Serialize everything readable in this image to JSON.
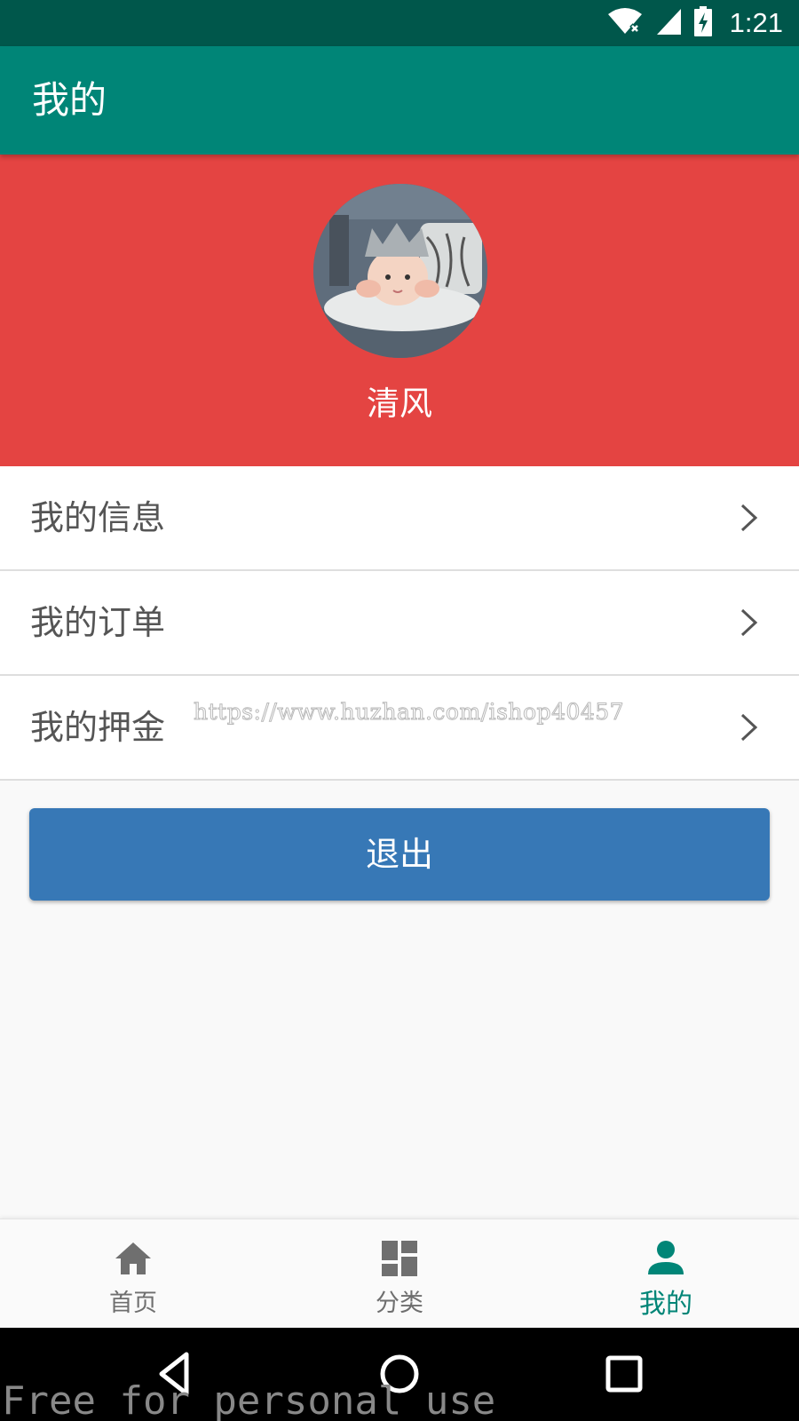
{
  "status_bar": {
    "time": "1:21",
    "icons": [
      "wifi-icon",
      "signal-icon",
      "battery-charging-icon"
    ]
  },
  "app_bar": {
    "title": "我的"
  },
  "profile": {
    "avatar_icon": "avatar-photo",
    "username": "清风",
    "background_color": "#e44442"
  },
  "menu": {
    "items": [
      {
        "label": "我的信息",
        "icon": "chevron-right-icon"
      },
      {
        "label": "我的订单",
        "icon": "chevron-right-icon"
      },
      {
        "label": "我的押金",
        "icon": "chevron-right-icon"
      }
    ]
  },
  "watermarks": {
    "url": "https://www.huzhan.com/ishop40457",
    "free": "Free for personal use"
  },
  "logout": {
    "label": "退出",
    "color": "#3778b6"
  },
  "bottom_nav": {
    "active_color": "#008577",
    "tabs": [
      {
        "label": "首页",
        "icon": "home-icon",
        "active": false
      },
      {
        "label": "分类",
        "icon": "dashboard-icon",
        "active": false
      },
      {
        "label": "我的",
        "icon": "person-icon",
        "active": true
      }
    ]
  },
  "system_nav": {
    "buttons": [
      "back-icon",
      "home-circle-icon",
      "recents-icon"
    ]
  },
  "colors": {
    "status_bar": "#00574b",
    "app_bar": "#008577"
  }
}
